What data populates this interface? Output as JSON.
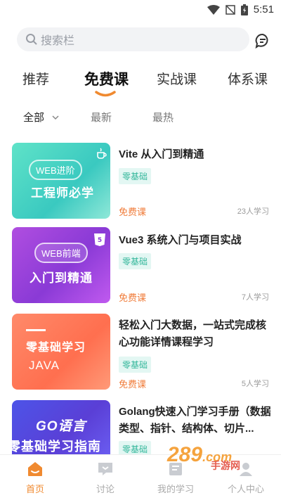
{
  "status": {
    "time": "5:51"
  },
  "search": {
    "placeholder": "搜索栏"
  },
  "tabs": [
    {
      "label": "推荐"
    },
    {
      "label": "免费课"
    },
    {
      "label": "实战课"
    },
    {
      "label": "体系课"
    }
  ],
  "filters": [
    {
      "label": "全部"
    },
    {
      "label": "最新"
    },
    {
      "label": "最热"
    }
  ],
  "courses": [
    {
      "thumb_tag": "WEB进阶",
      "thumb_text": "工程师必学",
      "title": "Vite 从入门到精通",
      "tag": "零基础",
      "price": "免费课",
      "learners": "23人学习"
    },
    {
      "thumb_tag": "WEB前端",
      "thumb_text": "入门到精通",
      "title": "Vue3 系统入门与项目实战",
      "tag": "零基础",
      "price": "免费课",
      "learners": "7人学习"
    },
    {
      "thumb_tag": "零基础学习",
      "thumb_text": "JAVA",
      "title": "轻松入门大数据，一站式完成核心功能详情课程学习",
      "tag": "零基础",
      "price": "免费课",
      "learners": "5人学习"
    },
    {
      "thumb_tag": "GO语言",
      "thumb_text": "零基础学习指南",
      "title": "Golang快速入门学习手册（数据类型、指针、结构体、切片...",
      "tag": "零基础"
    }
  ],
  "bottom_nav": [
    {
      "label": "首页"
    },
    {
      "label": "讨论"
    },
    {
      "label": "我的学习"
    },
    {
      "label": "个人中心"
    }
  ],
  "watermark": {
    "main": "289",
    "sub": "手游网",
    "domain": ".com"
  },
  "colors": {
    "accent": "#f08a30",
    "tag_bg": "#e3f7f3",
    "tag_text": "#34b79b",
    "price": "#f07c3a"
  }
}
